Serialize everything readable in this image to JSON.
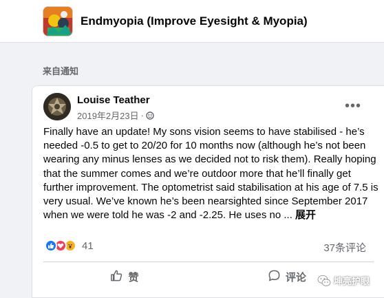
{
  "group": {
    "name": "Endmyopia (Improve Eyesight & Myopia)"
  },
  "section_label": "来自通知",
  "post": {
    "author": "Louise Teather",
    "date": "2019年2月23日",
    "separator": "·",
    "privacy_icon": "globe-icon",
    "more_label": "•••",
    "text": "Finally have an update! My sons vision seems to have stabilised - he’s needed -0.5 to get to 20/20 for 10 months now (although he’s not been wearing any minus lenses as we decided not to risk them). Really hoping that the summer comes and we’re outdoor more that he’ll finally get further improvement. The optometrist said stabilisation at his age of 7.5 is very usual. We’ve known he’s been nearsighted since September 2017 when we were told he was -2 and -2.25. He uses no ... ",
    "see_more": "展开",
    "reactions": {
      "icons": [
        "like-icon",
        "love-icon",
        "wow-icon"
      ],
      "count": "41"
    },
    "comment_count": "37条评论",
    "actions": {
      "like_label": "赞",
      "comment_label": "评论"
    }
  },
  "watermark": {
    "text": "坤亮护眼",
    "icon": "wechat-icon"
  },
  "colors": {
    "background": "#f0f2f5",
    "card": "#ffffff",
    "secondary_text": "#65676b",
    "like_blue": "#1877f2",
    "love_red": "#f33e58",
    "wow_yellow": "#f7b125"
  }
}
